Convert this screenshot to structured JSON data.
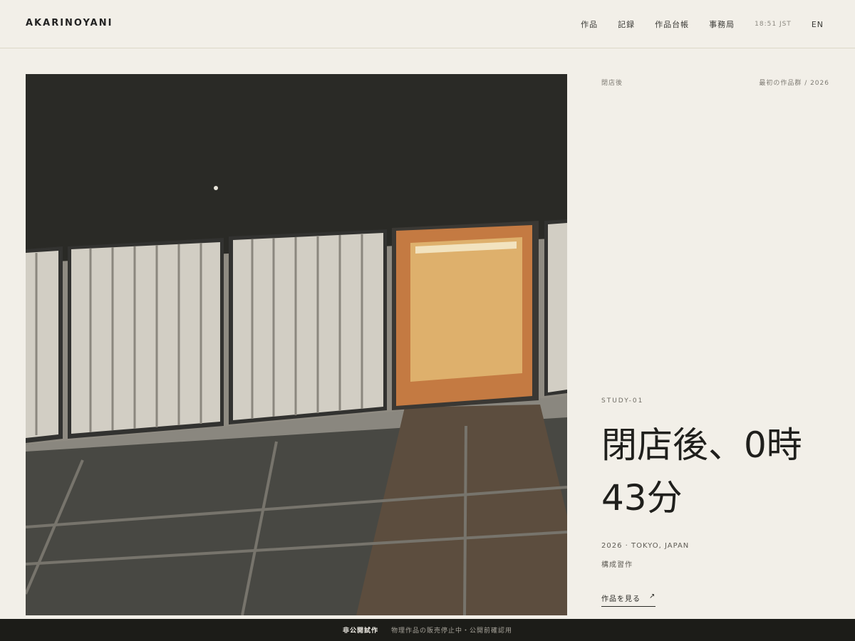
{
  "brand": {
    "name": "AKARINOYANI"
  },
  "nav": {
    "items": [
      "作品",
      "記録",
      "作品台帳",
      "事務局"
    ],
    "time": "18:51 JST",
    "lang": "EN"
  },
  "artwork": {
    "description_icon": "illustration-storefront-night"
  },
  "detail": {
    "category": "閉店後",
    "series": "最初の作品群 / 2026",
    "study_label": "STUDY-01",
    "title_line1": "閉店後、0時",
    "title_line2": "43分",
    "year_location": "2026 · TOKYO, JAPAN",
    "type": "構成習作",
    "cta_label": "作品を見る",
    "cta_icon": "↗"
  },
  "footer": {
    "badge": "非公開試作",
    "notice": "物理作品の販売停止中・公開前確認用"
  },
  "colors": {
    "background": "#f2efe8",
    "night": "#2a2a26",
    "shutter": "#d2cec4",
    "lit_frame": "#c47a42",
    "lit_panel": "#deb06c",
    "footer": "#1c1c18"
  }
}
